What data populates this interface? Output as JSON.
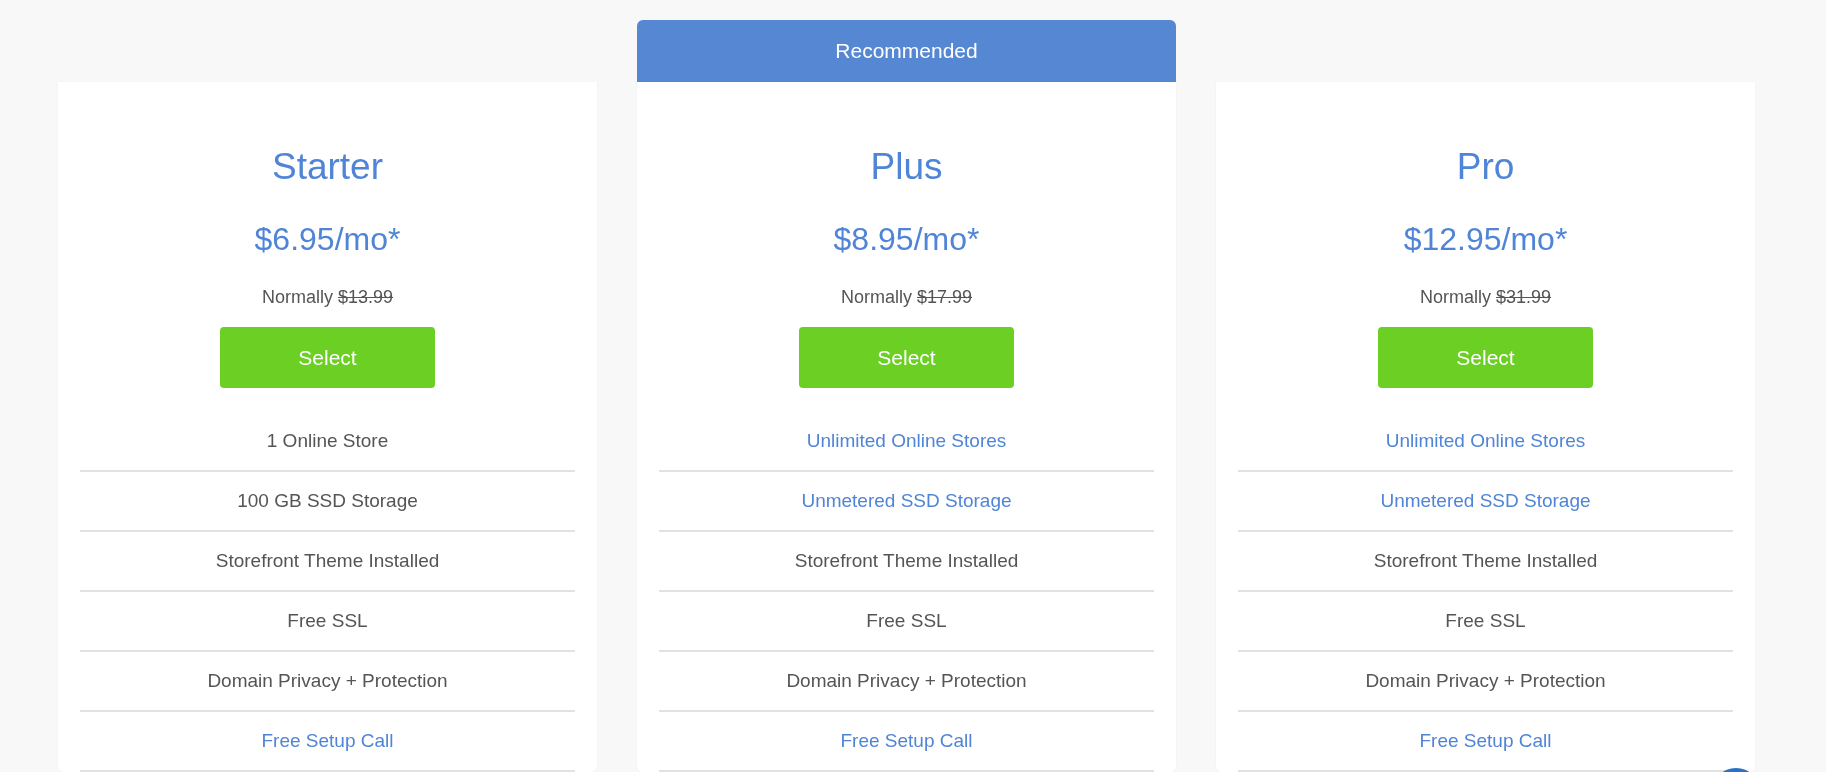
{
  "plans": [
    {
      "name": "Starter",
      "price": "$6.95/mo*",
      "normally_label": "Normally",
      "normal_price": "$13.99",
      "button": "Select",
      "features": [
        {
          "text": "1 Online Store",
          "highlighted": false
        },
        {
          "text": "100 GB SSD Storage",
          "highlighted": false
        },
        {
          "text": "Storefront Theme Installed",
          "highlighted": false
        },
        {
          "text": "Free SSL",
          "highlighted": false
        },
        {
          "text": "Domain Privacy + Protection",
          "highlighted": false
        },
        {
          "text": "Free Setup Call",
          "highlighted": true
        }
      ]
    },
    {
      "badge": "Recommended",
      "name": "Plus",
      "price": "$8.95/mo*",
      "normally_label": "Normally",
      "normal_price": "$17.99",
      "button": "Select",
      "features": [
        {
          "text": "Unlimited Online Stores",
          "highlighted": true
        },
        {
          "text": "Unmetered SSD Storage",
          "highlighted": true
        },
        {
          "text": "Storefront Theme Installed",
          "highlighted": false
        },
        {
          "text": "Free SSL",
          "highlighted": false
        },
        {
          "text": "Domain Privacy + Protection",
          "highlighted": false
        },
        {
          "text": "Free Setup Call",
          "highlighted": true
        }
      ]
    },
    {
      "name": "Pro",
      "price": "$12.95/mo*",
      "normally_label": "Normally",
      "normal_price": "$31.99",
      "button": "Select",
      "features": [
        {
          "text": "Unlimited Online Stores",
          "highlighted": true
        },
        {
          "text": "Unmetered SSD Storage",
          "highlighted": true
        },
        {
          "text": "Storefront Theme Installed",
          "highlighted": false
        },
        {
          "text": "Free SSL",
          "highlighted": false
        },
        {
          "text": "Domain Privacy + Protection",
          "highlighted": false
        },
        {
          "text": "Free Setup Call",
          "highlighted": true
        }
      ]
    }
  ]
}
